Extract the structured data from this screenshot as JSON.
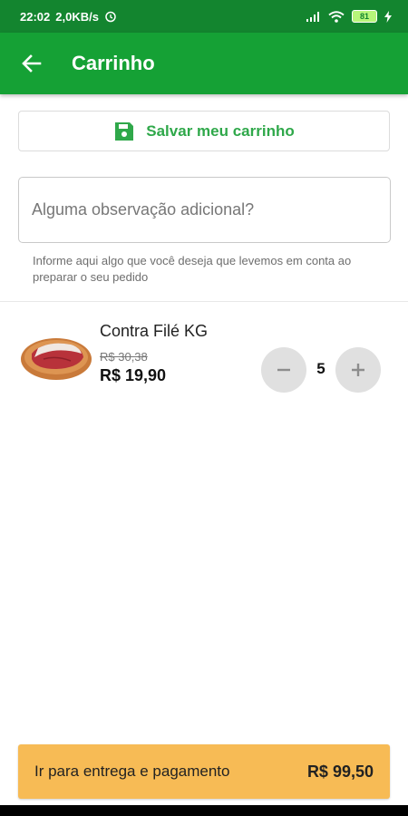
{
  "status_bar": {
    "time": "22:02",
    "network_speed": "2,0KB/s",
    "battery": "81"
  },
  "header": {
    "title": "Carrinho"
  },
  "save_cart": {
    "label": "Salvar meu carrinho"
  },
  "observation": {
    "placeholder": "Alguma observação adicional?",
    "helper": "Informe aqui algo que você deseja que levemos em conta ao preparar o seu pedido"
  },
  "cart": {
    "items": [
      {
        "name": "Contra Filé KG",
        "old_price": "R$ 30,38",
        "price": "R$ 19,90",
        "quantity": "5"
      }
    ]
  },
  "checkout": {
    "label": "Ir para entrega e pagamento",
    "total": "R$ 99,50"
  },
  "colors": {
    "header": "#15a135",
    "status_bar": "#13852f",
    "accent": "#2fa84a",
    "checkout": "#f7bb55"
  }
}
